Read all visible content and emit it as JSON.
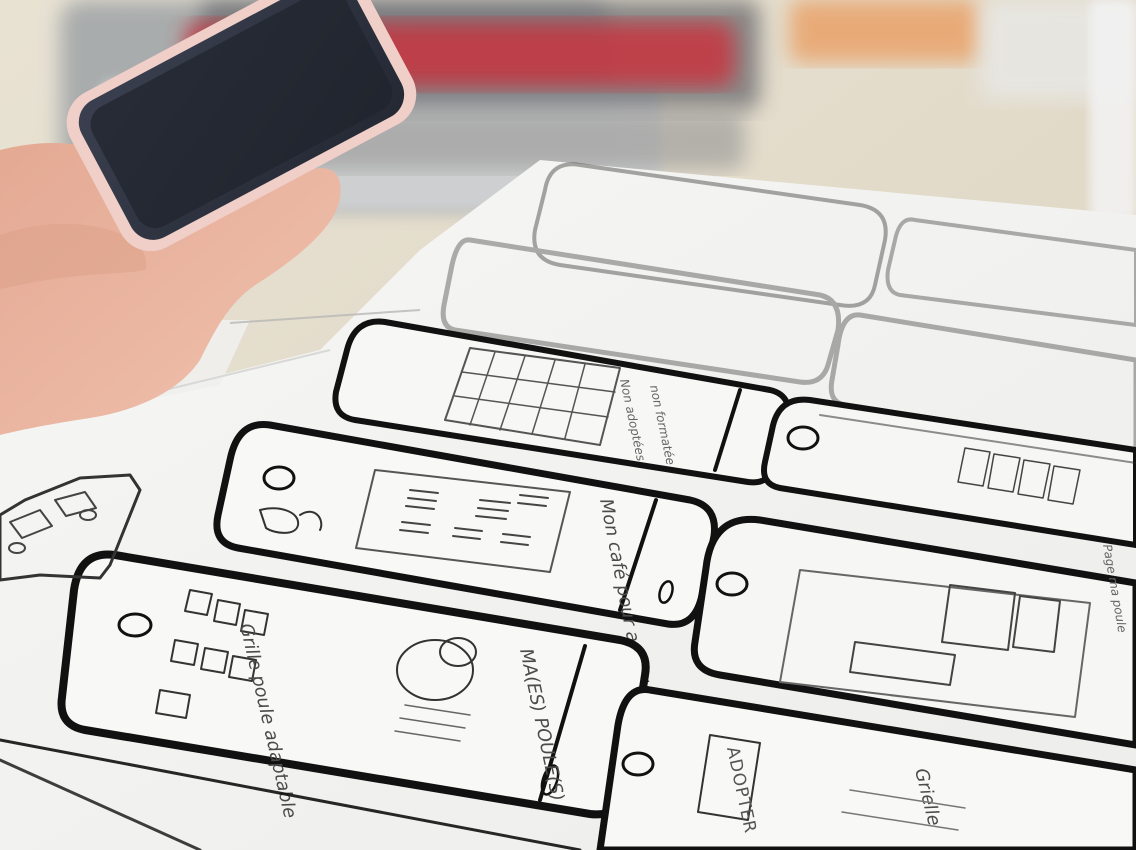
{
  "labels": {
    "screen_a": "Mon café pour accéder aux paralléles",
    "screen_b": "Grille poule adaptable",
    "screen_c": "MA(ES) POULE(S)",
    "screen_d": "ADOPTER",
    "screen_e": "Grielle",
    "screen_f": "Page ma poule"
  },
  "colors": {
    "paper": "#f3f3f1",
    "desk": "#e6dfcf",
    "ink": "#111111",
    "skin": "#e6b39f",
    "phone_case": "#efcfc8",
    "phone_screen": "#2d3240"
  }
}
